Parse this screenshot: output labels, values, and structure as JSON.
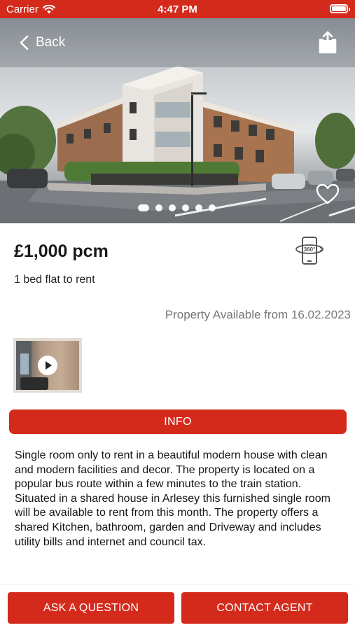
{
  "status_bar": {
    "carrier": "Carrier",
    "time": "4:47 PM",
    "wifi_icon": "wifi-icon",
    "battery_icon": "battery-icon"
  },
  "header": {
    "back_label": "Back",
    "back_icon": "chevron-left-icon",
    "share_icon": "share-icon",
    "favorite_icon": "heart-outline-icon"
  },
  "gallery": {
    "total_images": 6,
    "active_index": 0
  },
  "listing": {
    "price": "£1,000 pcm",
    "type": "1 bed flat to rent",
    "availability": "Property Available from 16.02.2023",
    "tour_icon": "360-view-icon",
    "video_icon": "play-icon"
  },
  "info": {
    "tab_label": "INFO",
    "description": "Single room only to rent in a beautiful modern house with clean and modern facilities and decor. The property is located on a popular bus route within a few minutes to the train station. Situated in a shared house in Arlesey this furnished single room will be available to rent from this month. The property offers a shared Kitchen, bathroom, garden and Driveway and includes utility bills and internet and council tax."
  },
  "actions": {
    "ask_label": "ASK A QUESTION",
    "contact_label": "CONTACT AGENT"
  },
  "colors": {
    "brand_red": "#d42a1c",
    "muted_text": "#777777"
  }
}
